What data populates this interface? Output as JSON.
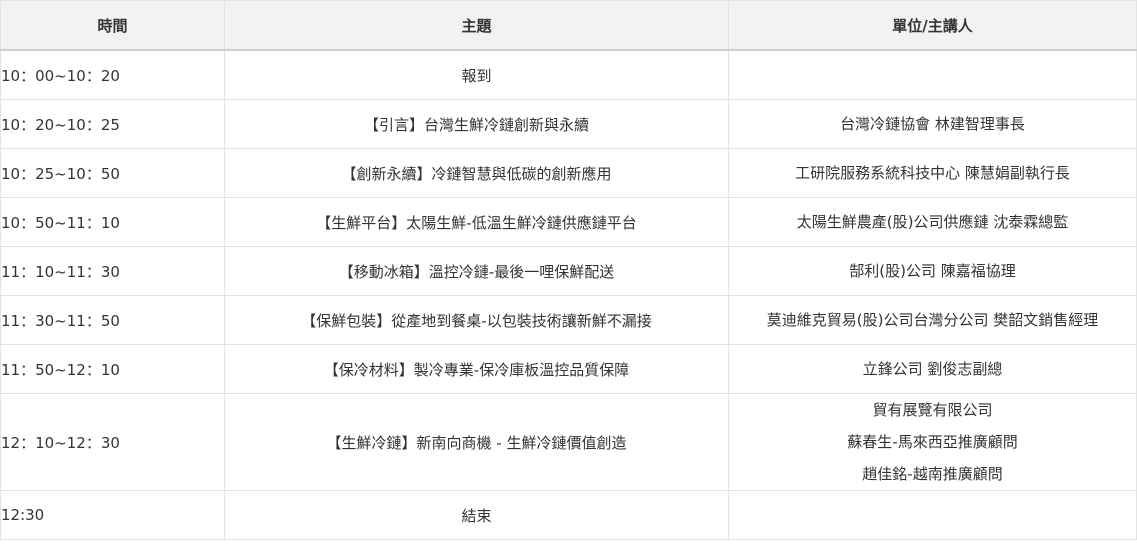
{
  "headers": {
    "time": "時間",
    "topic": "主題",
    "speaker": "單位/主講人"
  },
  "rows": [
    {
      "time": "10：00~10：20",
      "topic": "報到",
      "speaker": []
    },
    {
      "time": "10：20~10：25",
      "topic": "【引言】台灣生鮮冷鏈創新與永續",
      "speaker": [
        "台灣冷鏈協會  林建智理事長"
      ]
    },
    {
      "time": "10：25~10：50",
      "topic": "【創新永續】冷鏈智慧與低碳的創新應用",
      "speaker": [
        "工研院服務系統科技中心 陳慧娟副執行長"
      ]
    },
    {
      "time": "10：50~11：10",
      "topic": "【生鮮平台】太陽生鮮-低溫生鮮冷鏈供應鏈平台",
      "speaker": [
        "太陽生鮮農產(股)公司供應鏈 沈泰霖總監"
      ]
    },
    {
      "time": "11：10~11：30",
      "topic": "【移動冰箱】溫控冷鏈-最後一哩保鮮配送",
      "speaker": [
        "郜利(股)公司 陳嘉福協理"
      ]
    },
    {
      "time": "11：30~11：50",
      "topic": "【保鮮包裝】從產地到餐桌-以包裝技術讓新鮮不漏接",
      "speaker": [
        "莫迪維克貿易(股)公司台灣分公司 樊韶文銷售經理"
      ]
    },
    {
      "time": "11：50~12：10",
      "topic": "【保冷材料】製冷專業-保冷庫板溫控品質保障",
      "speaker": [
        "立鋒公司 劉俊志副總"
      ]
    },
    {
      "time": "12：10~12：30",
      "topic": "【生鮮冷鏈】新南向商機 - 生鮮冷鏈價值創造",
      "speaker": [
        "貿有展覽有限公司",
        "蘇春生-馬來西亞推廣顧問",
        "趙佳銘-越南推廣顧問"
      ]
    },
    {
      "time": "12:30",
      "topic": "結束",
      "speaker": []
    }
  ]
}
